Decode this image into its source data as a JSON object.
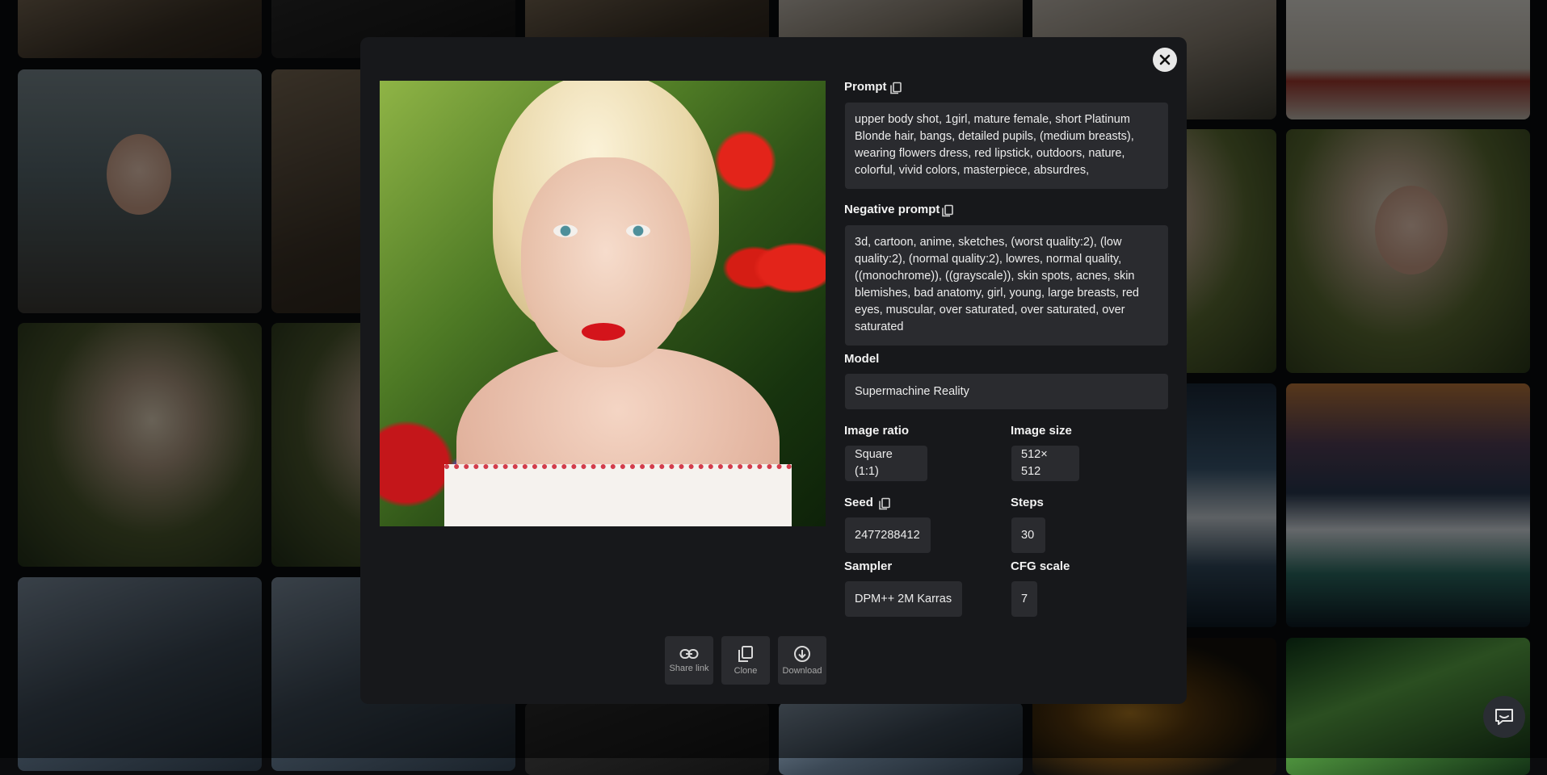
{
  "detail": {
    "prompt_label": "Prompt",
    "prompt_text": "upper body shot, 1girl, mature female, short Platinum Blonde hair, bangs, detailed pupils, (medium breasts), wearing flowers dress, red lipstick, outdoors, nature, colorful, vivid colors, masterpiece, absurdres,",
    "negative_label": "Negative prompt",
    "negative_text": "3d, cartoon, anime, sketches, (worst quality:2), (low quality:2), (normal quality:2), lowres, normal quality, ((monochrome)), ((grayscale)), skin spots, acnes, skin blemishes, bad anatomy, girl, young, large breasts, red eyes, muscular, over saturated, over saturated, over saturated",
    "model_label": "Model",
    "model_value": "Supermachine Reality",
    "ratio_label": "Image ratio",
    "ratio_value": "Square (1:1)",
    "size_label": "Image size",
    "size_value": "512× 512",
    "seed_label": "Seed",
    "seed_value": "2477288412",
    "steps_label": "Steps",
    "steps_value": "30",
    "sampler_label": "Sampler",
    "sampler_value": "DPM++ 2M Karras",
    "cfg_label": "CFG scale",
    "cfg_value": "7"
  },
  "actions": {
    "share_label": "Share link",
    "clone_label": "Clone",
    "download_label": "Download"
  },
  "icons": {
    "close": "close-icon",
    "copy": "copy-icon",
    "link": "link-icon",
    "clone": "clone-icon",
    "download": "download-icon",
    "chat": "chat-icon"
  },
  "colors": {
    "modal_bg": "#17181b",
    "field_bg": "#2a2b2f",
    "text": "#ececec"
  }
}
